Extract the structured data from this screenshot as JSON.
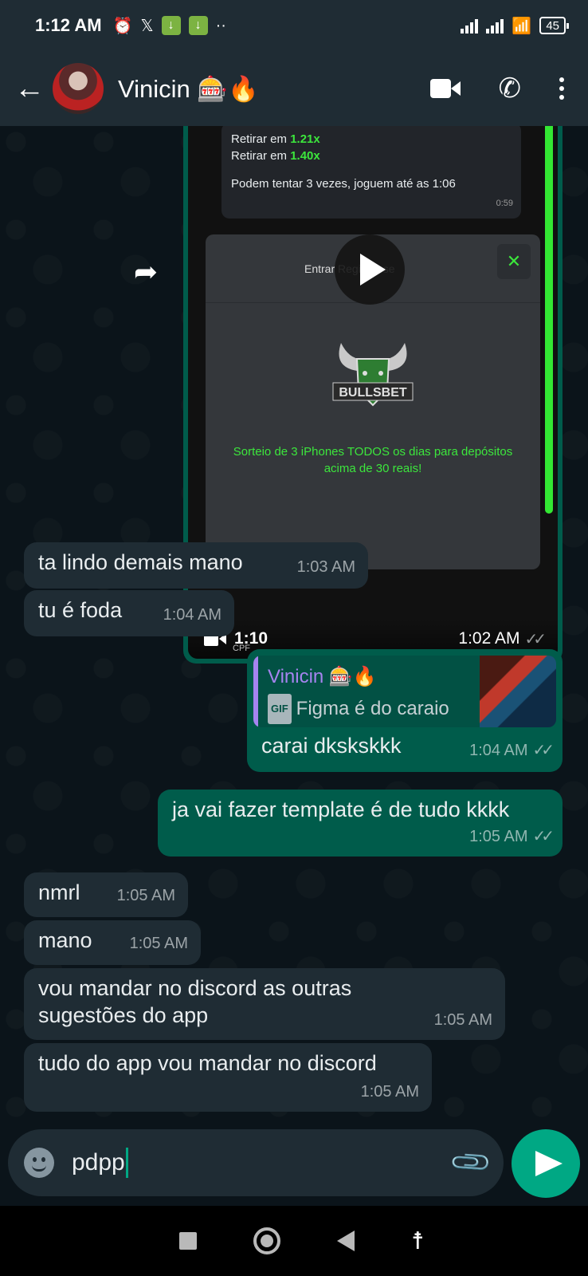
{
  "status_bar": {
    "time": "1:12 AM",
    "battery": "45",
    "icons": [
      "alarm-icon",
      "x-icon",
      "download-icon",
      "download-icon",
      "more-dots-icon",
      "signal-icon",
      "signal-icon",
      "wifi-icon",
      "battery-icon"
    ]
  },
  "header": {
    "contact_name": "Vinicin 🎰🔥"
  },
  "video_message": {
    "quoted_line_1_prefix": "Retirar em ",
    "quoted_line_1_value": "1.21x",
    "quoted_line_2_prefix": "Retirar em ",
    "quoted_line_2_value": "1.40x",
    "quoted_line_3": "Podem tentar 3 vezes, joguem até as 1:06",
    "quoted_time": "0:59",
    "card_top_text": "Entrar   Registre-se",
    "card_close": "✕",
    "logo_text": "BULLSBET",
    "promo_text": "Sorteio de 3 iPhones TODOS os dias para depósitos acima de 30 reais!",
    "cpf_text": "CPF",
    "duration": "1:10",
    "time": "1:02 AM",
    "ticks": "✓✓"
  },
  "messages": [
    {
      "id": "m1",
      "text": "ta lindo demais mano",
      "time": "1:03 AM"
    },
    {
      "id": "m2",
      "text": "tu é foda",
      "time": "1:04 AM"
    },
    {
      "id": "m3",
      "reply_author": "Vinicin 🎰🔥",
      "reply_gif": "GIF",
      "reply_text": "Figma é do caraio",
      "text": "carai dksksk​kk",
      "time": "1:04 AM",
      "ticks": "✓✓"
    },
    {
      "id": "m4",
      "text": "ja vai fazer template é de tudo kkkk",
      "time": "1:05 AM",
      "ticks": "✓✓"
    },
    {
      "id": "m5",
      "text": "nmrl",
      "time": "1:05 AM"
    },
    {
      "id": "m6",
      "text": "mano",
      "time": "1:05 AM"
    },
    {
      "id": "m7",
      "text_line_1": "vou mandar no discord as outras",
      "text_line_2": "sugestões do app",
      "time": "1:05 AM"
    },
    {
      "id": "m8",
      "text": "tudo do app vou mandar no discord",
      "time": "1:05 AM"
    }
  ],
  "composer": {
    "value": "pdpp"
  },
  "colors": {
    "background": "#0b141a",
    "incoming_bubble": "#1f2c34",
    "outgoing_bubble": "#005c4b",
    "accent": "#00a884"
  }
}
